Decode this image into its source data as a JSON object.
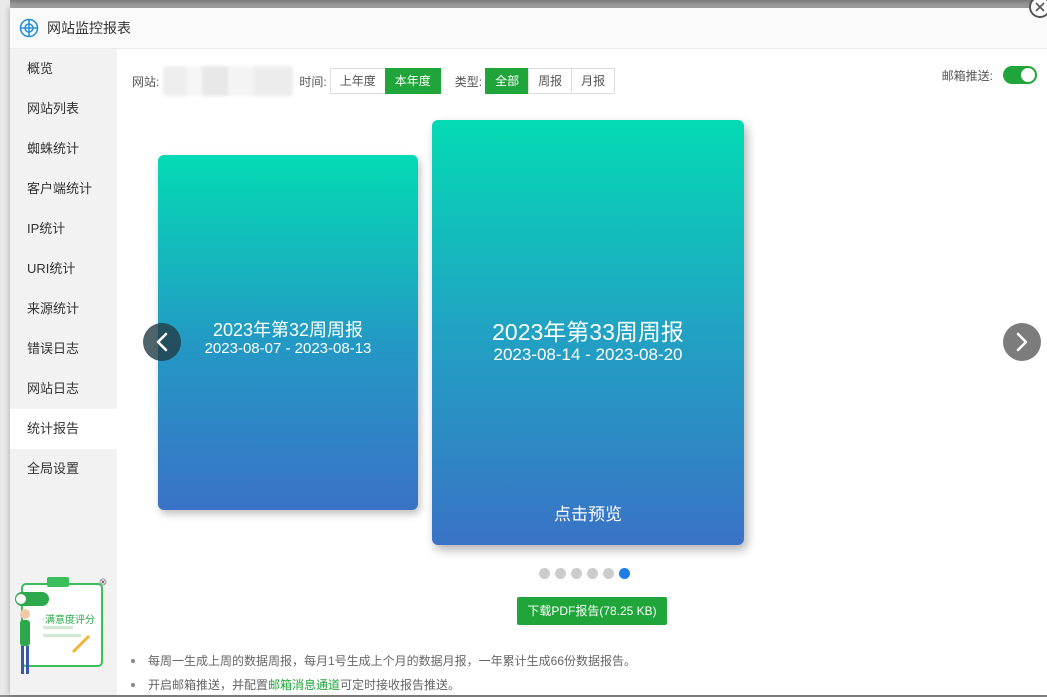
{
  "window": {
    "title": "网站监控报表"
  },
  "sidebar": {
    "items": [
      {
        "label": "概览"
      },
      {
        "label": "网站列表"
      },
      {
        "label": "蜘蛛统计"
      },
      {
        "label": "客户端统计"
      },
      {
        "label": "IP统计"
      },
      {
        "label": "URI统计"
      },
      {
        "label": "来源统计"
      },
      {
        "label": "错误日志"
      },
      {
        "label": "网站日志"
      },
      {
        "label": "统计报告",
        "active": true
      },
      {
        "label": "全局设置"
      }
    ]
  },
  "filters": {
    "site_label": "网站:",
    "time_label": "时间:",
    "time_options": [
      "上年度",
      "本年度"
    ],
    "time_selected": "本年度",
    "type_label": "类型:",
    "type_options": [
      "全部",
      "周报",
      "月报"
    ],
    "type_selected": "全部"
  },
  "email": {
    "label": "邮箱推送:",
    "enabled": true
  },
  "cards": [
    {
      "title": "2023年第32周周报",
      "date_range": "2023-08-07 - 2023-08-13"
    },
    {
      "title": "2023年第33周周报",
      "date_range": "2023-08-14 - 2023-08-20",
      "preview_label": "点击预览"
    }
  ],
  "carousel": {
    "dot_count": 6,
    "active_index": 5
  },
  "download": {
    "label": "下载PDF报告(78.25 KB)"
  },
  "notes": {
    "line1": "每周一生成上周的数据周报，每月1号生成上个月的数据月报，一年累计生成66份数据报告。",
    "line2_prefix": "开启邮箱推送，并配置",
    "line2_link": "邮箱消息通道",
    "line2_suffix": "可定时接收报告推送。"
  },
  "survey": {
    "label": "满意度评分"
  },
  "colors": {
    "accent": "#20a53a",
    "dot_active": "#1e7ce8"
  }
}
